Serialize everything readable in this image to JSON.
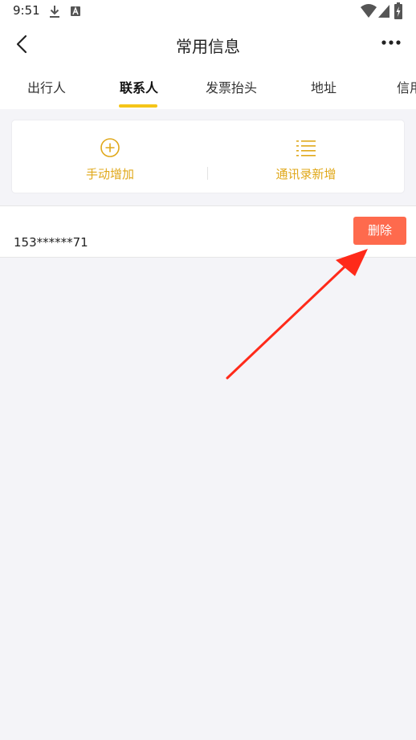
{
  "status_bar": {
    "time": "9:51"
  },
  "header": {
    "title": "常用信息"
  },
  "tabs": [
    {
      "label": "出行人"
    },
    {
      "label": "联系人",
      "active": true
    },
    {
      "label": "发票抬头"
    },
    {
      "label": "地址"
    },
    {
      "label": "信用"
    }
  ],
  "actions": {
    "manual_add": "手动增加",
    "contacts_add": "通讯录新增"
  },
  "contacts": [
    {
      "phone": "153******71",
      "delete_label": "删除"
    }
  ],
  "colors": {
    "accent": "#f5c518",
    "action_text": "#e0a81a",
    "delete_button": "#fe6a4d",
    "annotation_arrow": "#ff2a1a"
  }
}
